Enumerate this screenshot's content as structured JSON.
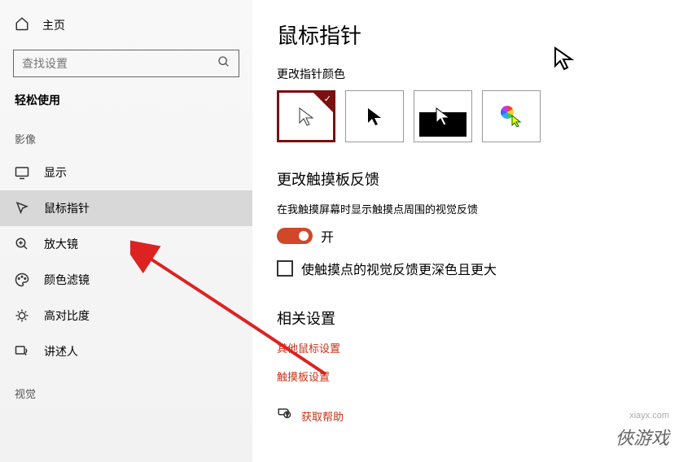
{
  "sidebar": {
    "home": "主页",
    "search_placeholder": "查找设置",
    "section_title": "轻松使用",
    "group_a": "影像",
    "group_b": "视觉",
    "items": [
      {
        "label": "显示",
        "icon": "monitor-icon"
      },
      {
        "label": "鼠标指针",
        "icon": "cursor-icon"
      },
      {
        "label": "放大镜",
        "icon": "magnifier-icon"
      },
      {
        "label": "颜色滤镜",
        "icon": "palette-icon"
      },
      {
        "label": "高对比度",
        "icon": "contrast-icon"
      },
      {
        "label": "讲述人",
        "icon": "narrator-icon"
      }
    ]
  },
  "main": {
    "title": "鼠标指针",
    "color_section": {
      "label": "更改指针颜色",
      "options": [
        "white",
        "black",
        "inverted",
        "custom-color"
      ]
    },
    "touch_section": {
      "title": "更改触摸板反馈",
      "desc": "在我触摸屏幕时显示触摸点周围的视觉反馈",
      "toggle_state": "开",
      "toggle_on": true,
      "checkbox_label": "使触摸点的视觉反馈更深色且更大"
    },
    "related": {
      "title": "相关设置",
      "links": [
        "其他鼠标设置",
        "触摸板设置"
      ]
    },
    "help": "获取帮助"
  },
  "watermark": {
    "url": "xiayx.com",
    "brand": "俠游戏"
  }
}
